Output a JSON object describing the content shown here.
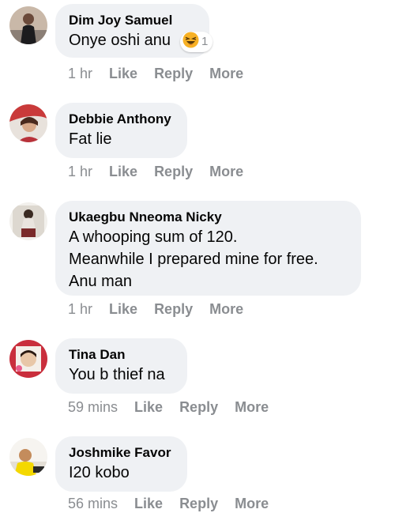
{
  "comments": [
    {
      "author": "Dim Joy Samuel",
      "text_lines": [
        "Onye oshi anu"
      ],
      "reaction": {
        "icon": "laughing-emoji",
        "count": "1"
      },
      "time": "1 hr"
    },
    {
      "author": "Debbie Anthony",
      "text_lines": [
        "Fat lie"
      ],
      "time": "1 hr"
    },
    {
      "author": "Ukaegbu Nneoma Nicky",
      "text_lines": [
        "A whooping sum of 120.",
        "Meanwhile I prepared mine for free.",
        "Anu man"
      ],
      "time": "1 hr"
    },
    {
      "author": "Tina Dan",
      "text_lines": [
        "You b thief na"
      ],
      "time": "59 mins"
    },
    {
      "author": "Joshmike Favor",
      "text_lines": [
        "I20 kobo"
      ],
      "time": "56 mins"
    }
  ],
  "actions": {
    "like": "Like",
    "reply": "Reply",
    "more": "More"
  },
  "colors": {
    "bubble": "#eff1f4",
    "meta_text": "#8a8d91",
    "body_text": "#050505"
  }
}
